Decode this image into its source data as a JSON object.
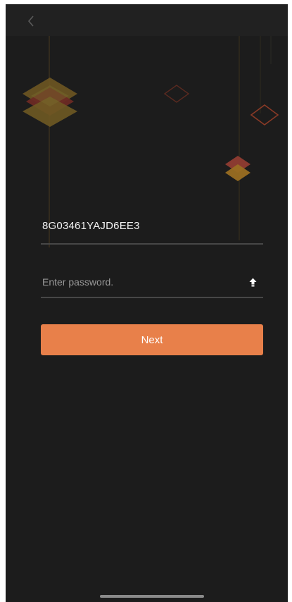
{
  "header": {
    "back_icon": "chevron-left-icon"
  },
  "login": {
    "account_id": "8G03461YAJD6EE3",
    "password_value": "",
    "password_placeholder": "Enter password.",
    "caps_lock_icon": "caps-lock-up-arrow-icon",
    "next_label": "Next"
  },
  "colors": {
    "background": "#1c1c1c",
    "header": "#212121",
    "accent": "#e8804a",
    "divider": "#474747",
    "text": "#f2f2f2",
    "placeholder": "#9a9a9a"
  }
}
